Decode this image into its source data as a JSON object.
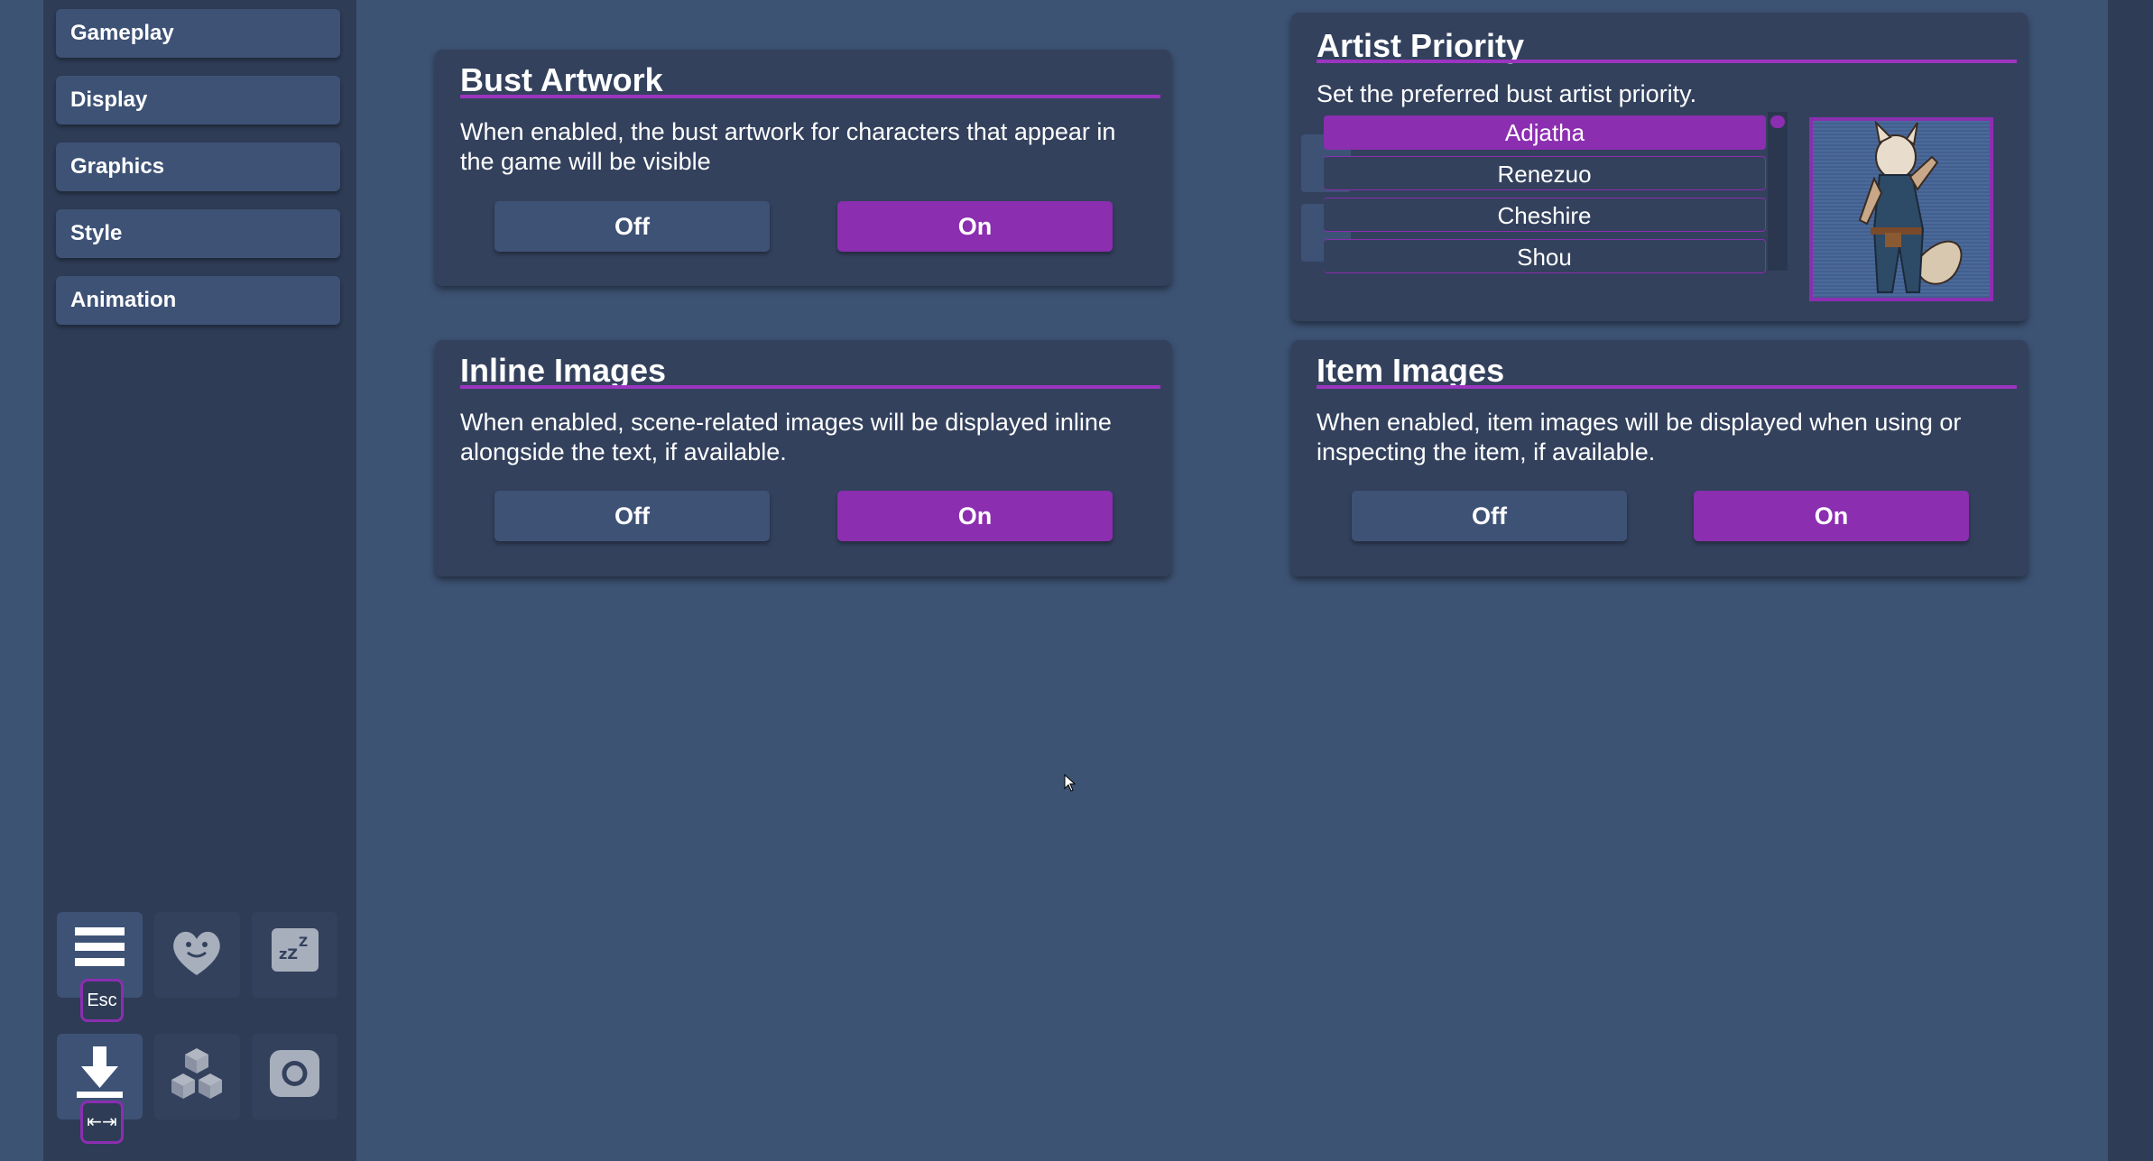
{
  "sidebar": {
    "items": [
      {
        "label": "Gameplay"
      },
      {
        "label": "Display"
      },
      {
        "label": "Graphics"
      },
      {
        "label": "Style"
      },
      {
        "label": "Animation"
      }
    ],
    "tools": [
      {
        "icon": "menu-icon",
        "key": "Esc"
      },
      {
        "icon": "heart-icon"
      },
      {
        "icon": "sleep-icon"
      },
      {
        "icon": "download-icon",
        "key": "⇤⇥"
      },
      {
        "icon": "cubes-icon"
      },
      {
        "icon": "screenshot-icon"
      }
    ]
  },
  "panels": {
    "bust_artwork": {
      "title": "Bust Artwork",
      "description": "When enabled, the bust artwork for characters that appear in the game will be visible",
      "off_label": "Off",
      "on_label": "On",
      "selected": "On"
    },
    "inline_images": {
      "title": "Inline Images",
      "description": "When enabled, scene-related images will be displayed inline alongside the text, if available.",
      "off_label": "Off",
      "on_label": "On",
      "selected": "On"
    },
    "artist_priority": {
      "title": "Artist Priority",
      "description": "Set the preferred bust artist priority.",
      "artists": [
        "Adjatha",
        "Renezuo",
        "Cheshire",
        "Shou"
      ],
      "selected": "Adjatha"
    },
    "item_images": {
      "title": "Item Images",
      "description": "When enabled, item images will be displayed when using or inspecting the item, if available.",
      "off_label": "Off",
      "on_label": "On",
      "selected": "On"
    }
  },
  "colors": {
    "accent": "#8b2eb0",
    "background": "#3d5374",
    "panel": "#33415d",
    "button": "#3e5276"
  }
}
